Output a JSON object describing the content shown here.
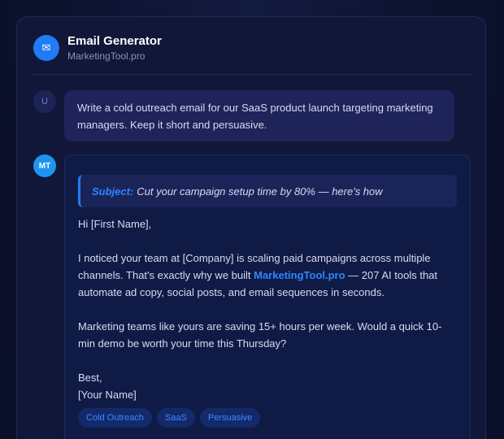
{
  "header": {
    "icon": "envelope-icon",
    "icon_glyph": "✉",
    "title": "Email Generator",
    "subtitle": "MarketingTool.pro"
  },
  "conversation": {
    "user": {
      "avatar": "U",
      "message": "Write a cold outreach email for our SaaS product launch targeting marketing managers. Keep it short and persuasive."
    },
    "assistant": {
      "avatar": "MT",
      "subject_label": "Subject:",
      "subject_text": "Cut your campaign setup time by 80% — here's how",
      "greeting": "Hi [First Name],",
      "para1_before": "I noticed your team at [Company] is scaling paid campaigns across multiple channels. That's exactly why we built ",
      "para1_link": "MarketingTool.pro",
      "para1_after": " — 207 AI tools that automate ad copy, social posts, and email sequences in seconds.",
      "para2": "Marketing teams like yours are saving 15+ hours per week. Would a quick 10-min demo be worth your time this Thursday?",
      "signoff": "Best,",
      "signature": "[Your Name]",
      "tags": [
        "Cold Outreach",
        "SaaS",
        "Persuasive"
      ]
    }
  },
  "colors": {
    "accent": "#1f7bf6",
    "link": "#2f86ff",
    "background": "#0d1230",
    "card": "#111739",
    "user_bubble": "#1e2459",
    "assistant_bubble": "#0f1b45"
  }
}
